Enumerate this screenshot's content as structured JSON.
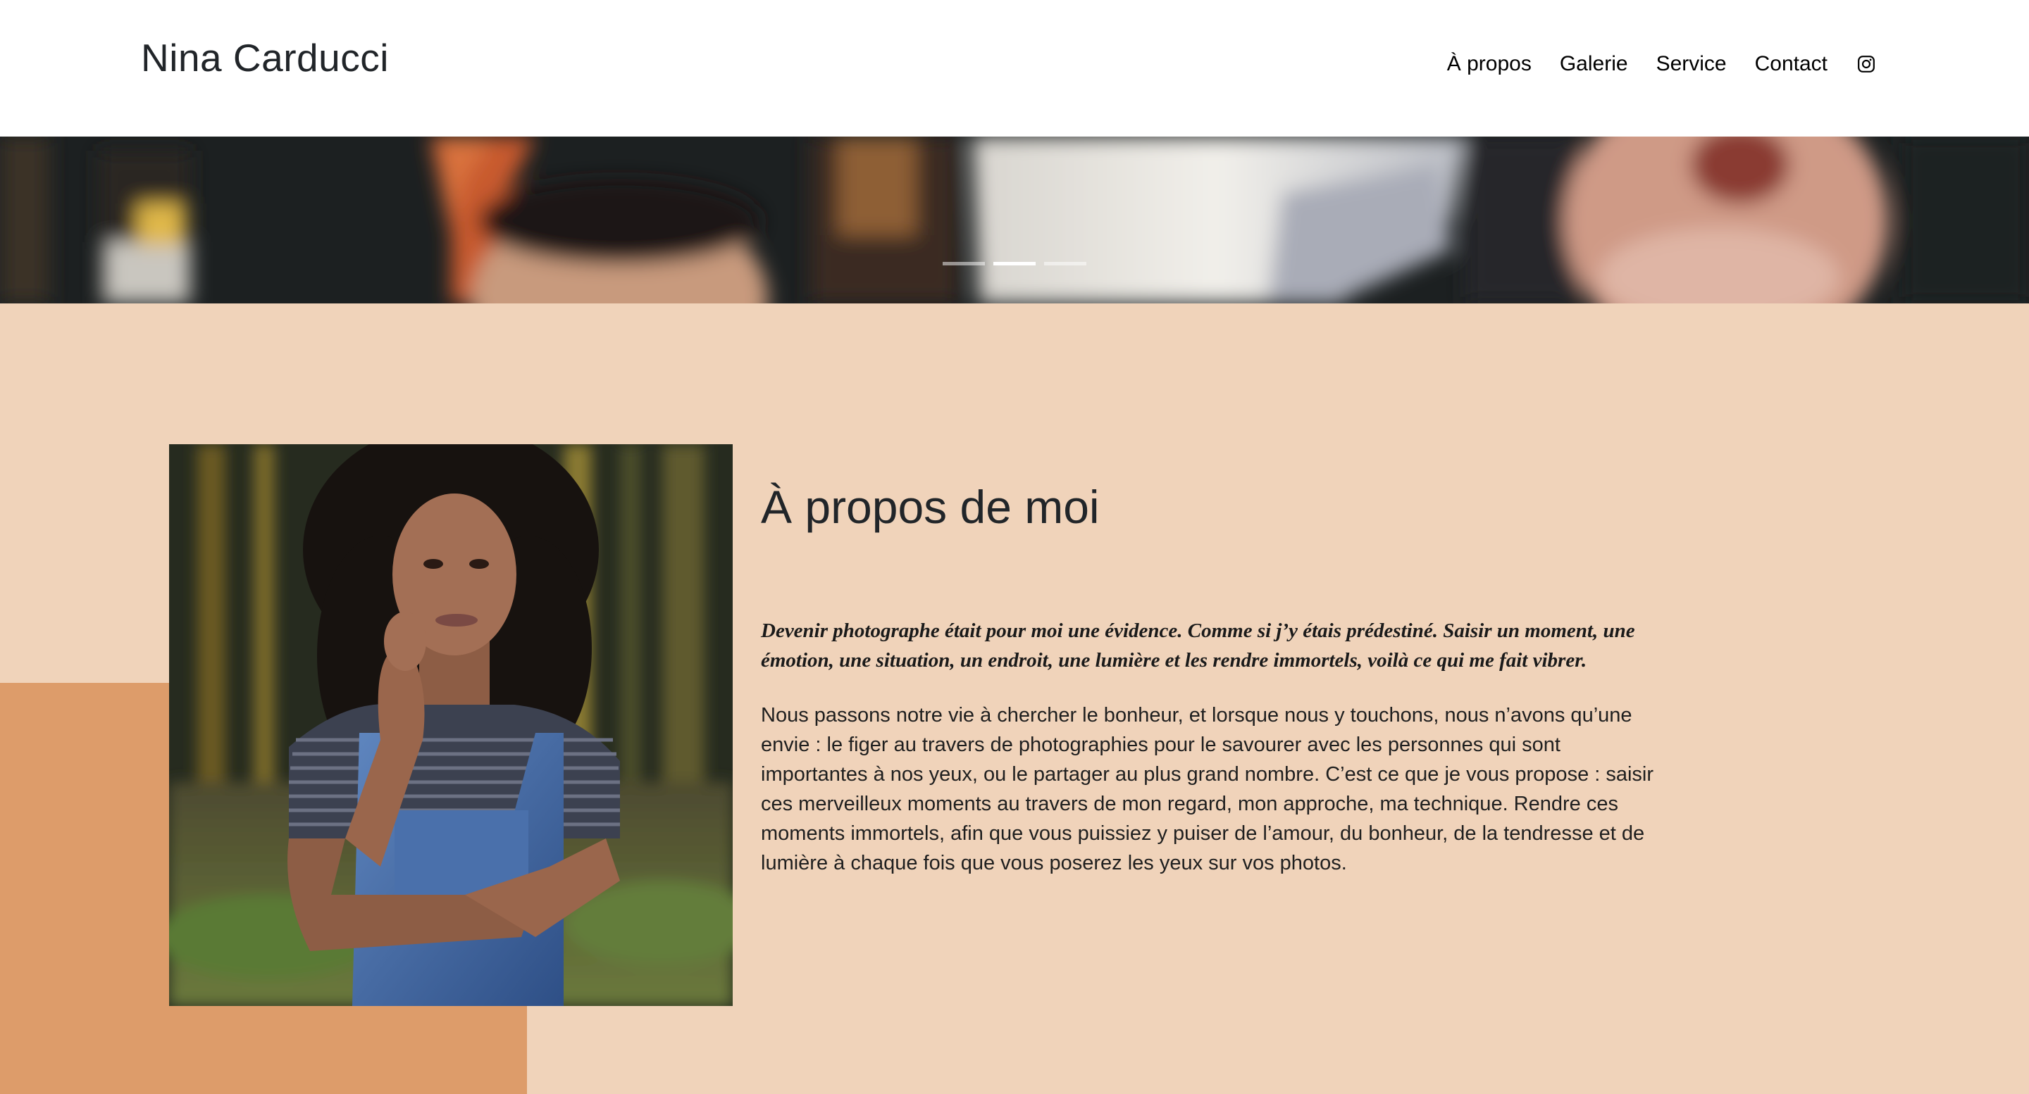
{
  "header": {
    "brand": "Nina Carducci",
    "nav": [
      {
        "label": "À propos"
      },
      {
        "label": "Galerie"
      },
      {
        "label": "Service"
      },
      {
        "label": "Contact"
      }
    ],
    "instagram_icon": "instagram-icon"
  },
  "carousel": {
    "slide_count": 3,
    "active_index": 1
  },
  "about": {
    "title": "À propos de moi",
    "quote": "Devenir photographe était pour moi une évidence. Comme si j’y étais prédestiné. Saisir un moment, une émotion, une situation, un endroit, une lumière et les rendre immortels, voilà ce qui me fait vibrer.",
    "body": "Nous passons notre vie à chercher le bonheur, et lorsque nous y touchons, nous n’avons qu’une envie : le figer au travers de photographies pour le savourer avec les personnes qui sont importantes à nos yeux, ou le partager au plus grand nombre. C’est ce que je vous propose : saisir ces merveilleux moments au travers de mon regard, mon approche, ma technique. Rendre ces moments immortels, afin que vous puissiez y puiser de l’amour, du bonheur, de la tendresse et de lumière à chaque fois que vous poserez les yeux sur vos photos."
  },
  "colors": {
    "section_bg": "#f0d3ba",
    "accent": "#dd9c6a",
    "text": "#212529"
  }
}
